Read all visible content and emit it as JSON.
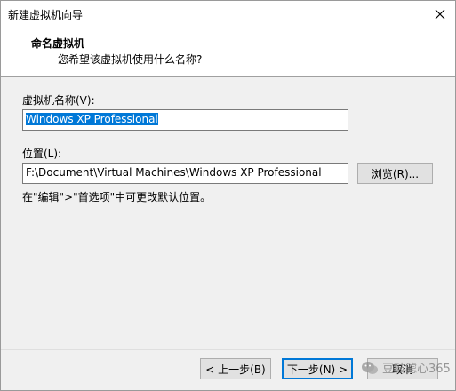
{
  "window": {
    "title": "新建虚拟机向导"
  },
  "header": {
    "title": "命名虚拟机",
    "subtitle": "您希望该虚拟机使用什么名称?"
  },
  "form": {
    "name_label": "虚拟机名称(V):",
    "name_value": "Windows XP Professional",
    "location_label": "位置(L):",
    "location_value": "F:\\Document\\Virtual Machines\\Windows XP Professional",
    "browse_label": "浏览(R)...",
    "hint": "在\"编辑\">\"首选项\"中可更改默认位置。"
  },
  "footer": {
    "back_label": "< 上一步(B)",
    "next_label": "下一步(N) >",
    "cancel_label": "取消"
  },
  "watermark": {
    "text": "豆豉滤心365"
  },
  "icons": {
    "close": "close-icon",
    "watermark": "wechat-icon"
  },
  "colors": {
    "selection": "#0078d7",
    "window_bg": "#f0f0f0",
    "header_bg": "#ffffff"
  }
}
